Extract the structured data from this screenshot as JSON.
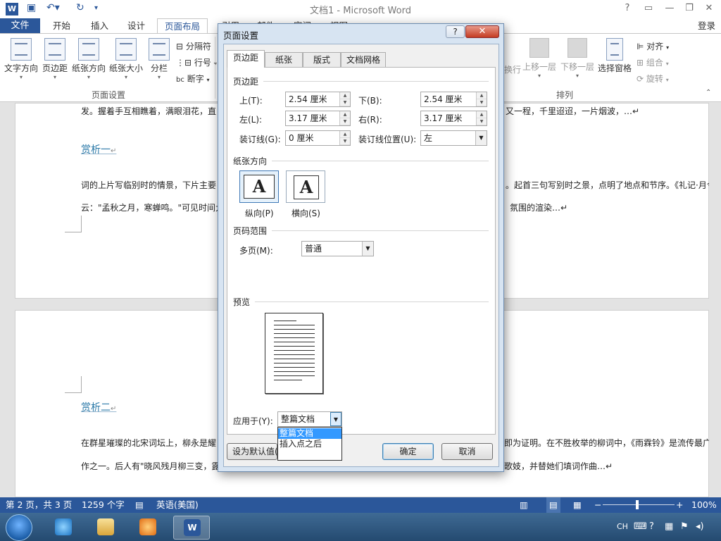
{
  "titlebar": {
    "title": "文档1 - Microsoft Word",
    "app_icon": "W",
    "qa_icons": [
      "save-icon",
      "undo-icon",
      "redo-icon",
      "customize-icon"
    ],
    "controls": [
      "?",
      "▭",
      "—",
      "❐",
      "✕"
    ]
  },
  "tabs": {
    "file": "文件",
    "items": [
      "开始",
      "插入",
      "设计",
      "页面布局",
      "引用",
      "邮件",
      "审阅",
      "视图"
    ],
    "active": "页面布局",
    "login": "登录"
  },
  "ribbon": {
    "page_setup": {
      "buttons": [
        "文字方向",
        "页边距",
        "纸张方向",
        "纸张大小",
        "分栏"
      ],
      "small": [
        "分隔符",
        "行号",
        "断字"
      ],
      "group_label": "页面设置"
    },
    "arrange": {
      "buttons": [
        "换行",
        "上移一层",
        "下移一层",
        "选择窗格"
      ],
      "small": [
        "对齐",
        "组合",
        "旋转"
      ],
      "group_label": "排列"
    }
  },
  "document": {
    "line1_left": "发。握着手互相瞧着，满眼泪花，直",
    "line1_right": "又一程，千里迢迢，一片烟波，…↵",
    "heading1": "赏析一",
    "para_a_left": "词的上片写临别时的情景，下片主要",
    "para_a_right": "。起首三句写别时之景，点明了地点和节序。《礼记·月令",
    "para_b_left": "云：\"孟秋之月，寒蝉鸣。\"可见时间大",
    "para_b_right": "氛围的渲染…↵",
    "heading2": "赏析二",
    "para_c_left": "在群星璀璨的北宋词坛上，柳永是耀",
    "para_c_right": "即为证明。在不胜枚举的柳词中，《雨霖铃》是流传最广",
    "para_d_left": "作之一。后人有\"晓风残月柳三变，露",
    "para_d_right": "歌妓，并替她们填词作曲…↵",
    "return_mark": "↵"
  },
  "status": {
    "page": "第 2 页，共 3 页",
    "words": "1259 个字",
    "lang": "英语(美国)",
    "zoom": "100%",
    "zoom_level": 1.0
  },
  "taskbar": {
    "tray": "CH",
    "apps": [
      "ie-icon",
      "explorer-icon",
      "media-player-icon",
      "word-icon"
    ]
  },
  "dialog": {
    "title": "页面设置",
    "help": "?",
    "close": "✕",
    "tabs": [
      "页边距",
      "纸张",
      "版式",
      "文档网格"
    ],
    "active_tab": "页边距",
    "margins": {
      "section": "页边距",
      "top_label": "上(T):",
      "top_value": "2.54 厘米",
      "bottom_label": "下(B):",
      "bottom_value": "2.54 厘米",
      "left_label": "左(L):",
      "left_value": "3.17 厘米",
      "right_label": "右(R):",
      "right_value": "3.17 厘米",
      "gutter_label": "装订线(G):",
      "gutter_value": "0 厘米",
      "gutter_pos_label": "装订线位置(U):",
      "gutter_pos_value": "左"
    },
    "orientation": {
      "section": "纸张方向",
      "portrait": "纵向(P)",
      "landscape": "横向(S)",
      "glyph": "A",
      "selected": "纵向(P)"
    },
    "pages": {
      "section": "页码范围",
      "multi_label": "多页(M):",
      "multi_value": "普通"
    },
    "preview": {
      "section": "预览"
    },
    "apply": {
      "label": "应用于(Y):",
      "value": "整篇文档",
      "options": [
        "整篇文档",
        "插入点之后"
      ],
      "highlighted": "整篇文档"
    },
    "buttons": {
      "default": "设为默认值(D)",
      "ok": "确定",
      "cancel": "取消"
    }
  },
  "colors": {
    "accent": "#2b579a",
    "selection": "#3399ff",
    "dialog_frame": "#d7e4f2"
  }
}
